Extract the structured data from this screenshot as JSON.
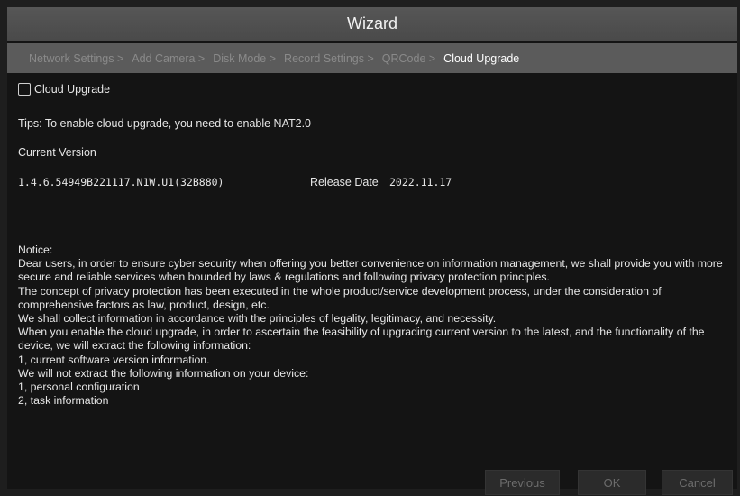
{
  "window": {
    "title": "Wizard"
  },
  "steps": [
    {
      "label": "Network Settings >"
    },
    {
      "label": "Add Camera >"
    },
    {
      "label": "Disk Mode >"
    },
    {
      "label": "Record Settings >"
    },
    {
      "label": "QRCode >"
    },
    {
      "label": "Cloud Upgrade"
    }
  ],
  "cloud_upgrade": {
    "checkbox_label": "Cloud Upgrade",
    "checked": false,
    "tips": "Tips: To enable cloud upgrade, you need to enable NAT2.0",
    "current_version_label": "Current Version",
    "version": "1.4.6.54949B221117.N1W.U1(32B880)",
    "release_date_label": "Release Date",
    "release_date": "2022.11.17"
  },
  "notice": [
    "Notice:",
    "Dear users, in order to ensure cyber security when offering you better convenience on information management, we shall provide you with more secure and reliable services when bounded by laws & regulations and following privacy protection principles.",
    "The concept of privacy protection has been executed in the whole product/service development process, under the consideration of comprehensive factors as law, product, design, etc.",
    "We shall collect information in accordance with the principles of legality, legitimacy, and necessity.",
    "When you enable the cloud upgrade, in order to ascertain the feasibility of upgrading current version to the latest, and the functionality of the device, we will extract the following information:",
    "1, current software version information.",
    "We will not extract the following information on your device:",
    "1, personal configuration",
    "2, task information"
  ],
  "buttons": {
    "previous": "Previous",
    "ok": "OK",
    "cancel": "Cancel"
  }
}
